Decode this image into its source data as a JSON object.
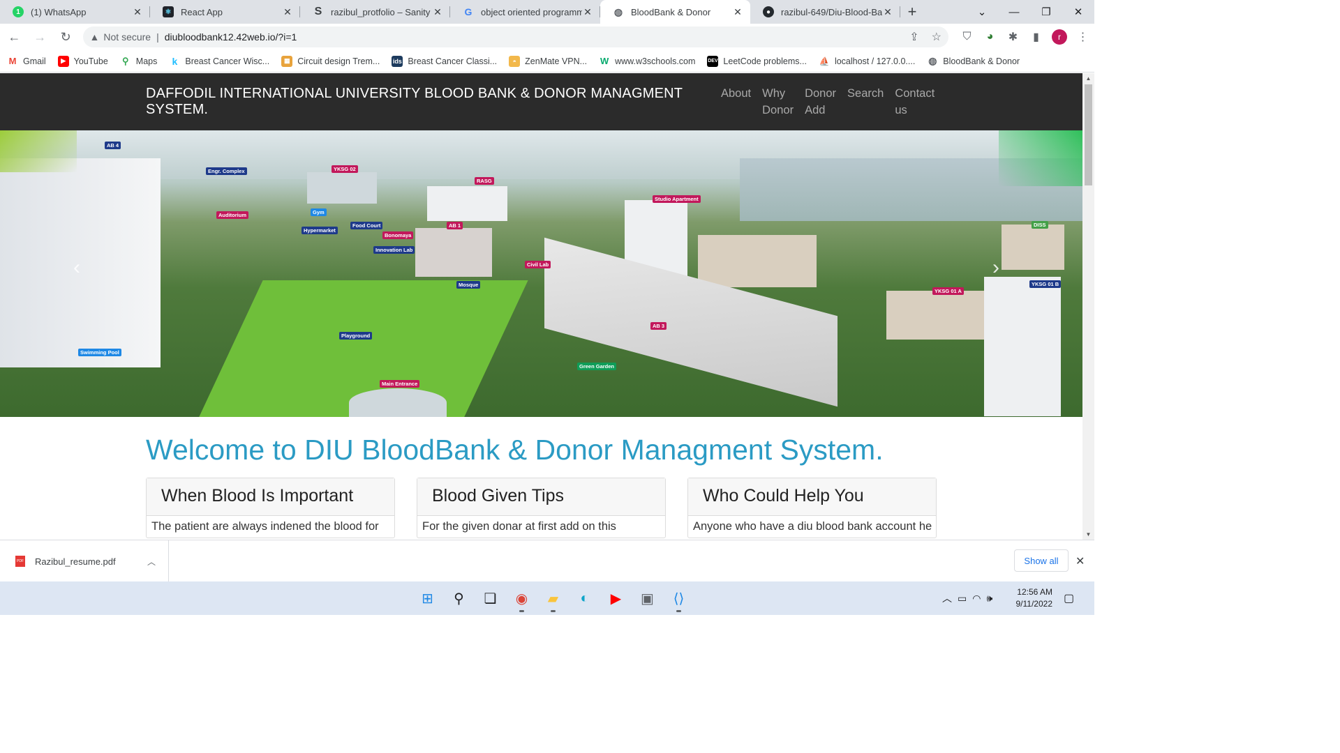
{
  "browser": {
    "tabs": [
      {
        "title": "(1) WhatsApp",
        "icon": "whatsapp-icon",
        "color": "#25d366"
      },
      {
        "title": "React App",
        "icon": "react-icon",
        "color": "#20232a"
      },
      {
        "title": "razibul_protfolio – Sanity",
        "icon": "sanity-icon",
        "color": "#3c4043"
      },
      {
        "title": "object oriented programmi",
        "icon": "google-icon",
        "color": "#4285f4"
      },
      {
        "title": "BloodBank & Donor",
        "icon": "globe-icon",
        "color": "#5f6368"
      },
      {
        "title": "razibul-649/Diu-Blood-Ban",
        "icon": "github-icon",
        "color": "#24292e"
      }
    ],
    "security_label": "Not secure",
    "url": "diubloodbank12.42web.io/?i=1",
    "profile_initial": "r",
    "bookmarks": [
      {
        "label": "Gmail",
        "icon": "gmail-icon",
        "color": "#ea4335"
      },
      {
        "label": "YouTube",
        "icon": "youtube-icon",
        "color": "#ff0000"
      },
      {
        "label": "Maps",
        "icon": "maps-icon",
        "color": "#34a853"
      },
      {
        "label": "Breast Cancer Wisc...",
        "icon": "kaggle-icon",
        "color": "#20beff"
      },
      {
        "label": "Circuit design Trem...",
        "icon": "tinkercad-icon",
        "color": "#e8a33c"
      },
      {
        "label": "Breast Cancer Classi...",
        "icon": "dataset-icon",
        "color": "#1d3b5e"
      },
      {
        "label": "ZenMate VPN...",
        "icon": "zenmate-icon",
        "color": "#f2b84b"
      },
      {
        "label": "www.w3schools.com",
        "icon": "w3schools-icon",
        "color": "#04aa6d"
      },
      {
        "label": "LeetCode problems...",
        "icon": "dev-icon",
        "color": "#000000"
      },
      {
        "label": "localhost / 127.0.0....",
        "icon": "phpmyadmin-icon",
        "color": "#f89c0e"
      },
      {
        "label": "BloodBank & Donor",
        "icon": "globe-icon",
        "color": "#5f6368"
      }
    ]
  },
  "site": {
    "brand": "DAFFODIL INTERNATIONAL UNIVERSITY BLOOD BANK & DONOR MANAGMENT SYSTEM.",
    "nav": [
      {
        "line1": "About",
        "line2": ""
      },
      {
        "line1": "Why",
        "line2": "Donor"
      },
      {
        "line1": "Donor",
        "line2": "Add"
      },
      {
        "line1": "Search",
        "line2": ""
      },
      {
        "line1": "Contact",
        "line2": "us"
      }
    ],
    "hero_labels": [
      {
        "text": "AB 4",
        "color": "#1e3a8a"
      },
      {
        "text": "Engr. Complex",
        "color": "#1e3a8a"
      },
      {
        "text": "YKSG 02",
        "color": "#c2185b"
      },
      {
        "text": "RASG",
        "color": "#c2185b"
      },
      {
        "text": "Auditorium",
        "color": "#c2185b"
      },
      {
        "text": "Gym",
        "color": "#1e88e5"
      },
      {
        "text": "Hypermarket",
        "color": "#1e3a8a"
      },
      {
        "text": "Food Court",
        "color": "#1e3a8a"
      },
      {
        "text": "Bonomaya",
        "color": "#c2185b"
      },
      {
        "text": "Innovation Lab",
        "color": "#1e3a8a"
      },
      {
        "text": "AB 1",
        "color": "#c2185b"
      },
      {
        "text": "Studio Apartment",
        "color": "#c2185b"
      },
      {
        "text": "Civil Lab",
        "color": "#c2185b"
      },
      {
        "text": "Mosque",
        "color": "#1e3a8a"
      },
      {
        "text": "AB 3",
        "color": "#c2185b"
      },
      {
        "text": "Playground",
        "color": "#1e3a8a"
      },
      {
        "text": "Swimming Pool",
        "color": "#1e88e5"
      },
      {
        "text": "Green Garden",
        "color": "#0f9d58"
      },
      {
        "text": "Main Entrance",
        "color": "#c2185b"
      },
      {
        "text": "DISS",
        "color": "#43a047"
      },
      {
        "text": "YKSG 01 A",
        "color": "#c2185b"
      },
      {
        "text": "YKSG 01 B",
        "color": "#1e3a8a"
      }
    ],
    "welcome": "Welcome to DIU BloodBank & Donor Managment System.",
    "cards": [
      {
        "title": "When Blood Is Important",
        "body": "The patient are always indened the blood for"
      },
      {
        "title": "Blood Given Tips",
        "body": "For the given donar at first add on this"
      },
      {
        "title": "Who Could Help You",
        "body": "Anyone who have a diu blood bank account he"
      }
    ]
  },
  "download": {
    "filename": "Razibul_resume.pdf",
    "show_all": "Show all"
  },
  "taskbar": {
    "apps": [
      "windows-start-icon",
      "search-icon",
      "task-view-icon",
      "chrome-icon",
      "file-explorer-icon",
      "edge-icon",
      "youtube-icon",
      "app-m-icon",
      "vscode-icon"
    ],
    "time": "12:56 AM",
    "date": "9/11/2022"
  }
}
